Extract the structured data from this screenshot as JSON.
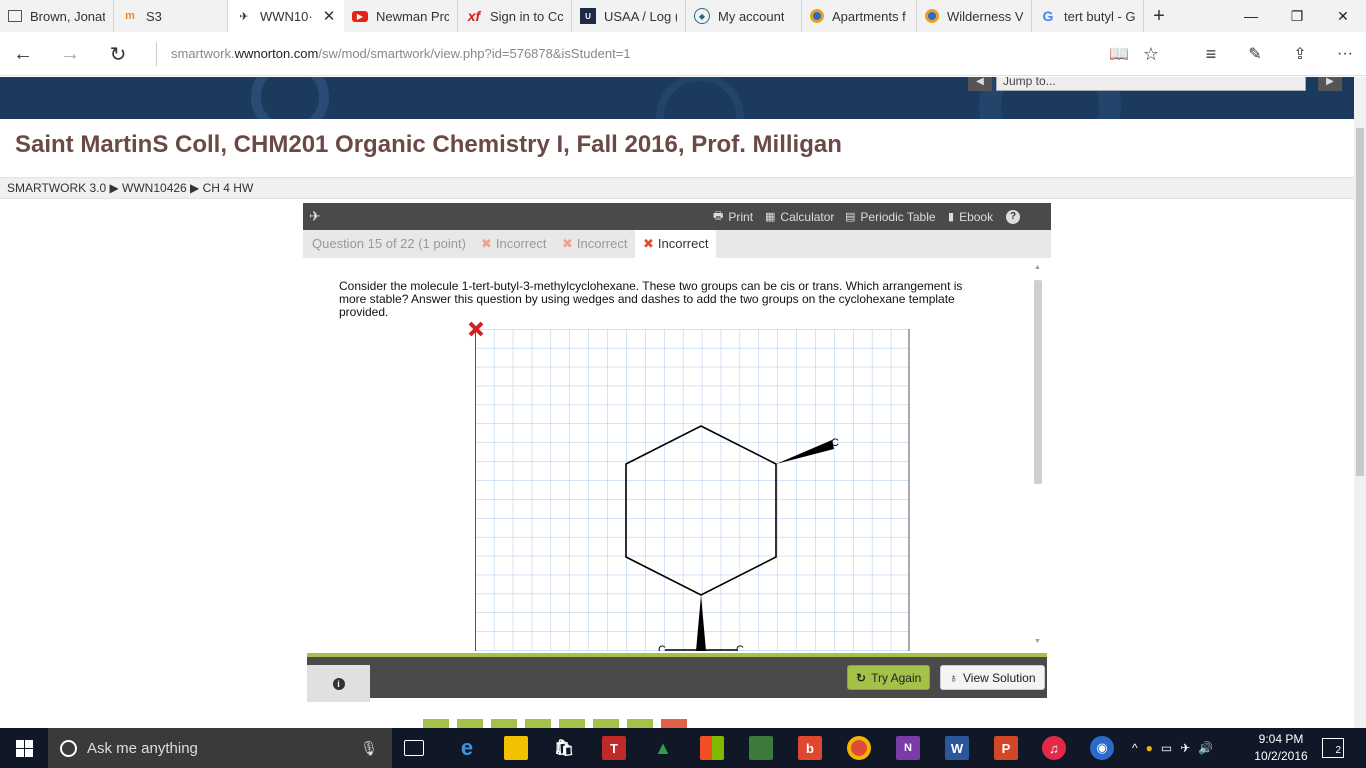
{
  "tabs": [
    {
      "icon": "document-icon",
      "label": "Brown, Jonat"
    },
    {
      "icon": "moodle-icon",
      "label": "S3"
    },
    {
      "icon": "norton-icon",
      "label": "WWN10·"
    },
    {
      "icon": "youtube-icon",
      "label": "Newman Prc"
    },
    {
      "icon": "xf-icon",
      "label": "Sign in to Cc"
    },
    {
      "icon": "usaa-icon",
      "label": "USAA / Log ("
    },
    {
      "icon": "account-icon",
      "label": "My account"
    },
    {
      "icon": "chrome-icon",
      "label": "Apartments f"
    },
    {
      "icon": "chrome-icon",
      "label": "Wilderness V"
    },
    {
      "icon": "google-icon",
      "label": "tert butyl - G"
    }
  ],
  "browser": {
    "url_prefix": "smartwork.",
    "url_domain": "wwnorton.com",
    "url_path": "/sw/mod/smartwork/view.php?id=576878&isStudent=1"
  },
  "banner": {
    "jump_label": "Jump to..."
  },
  "course_title": "Saint MartinS Coll, CHM201 Organic Chemistry I, Fall 2016, Prof. Milligan",
  "breadcrumb": "SMARTWORK 3.0 ▶ WWN10426 ▶ CH 4 HW",
  "toolbar": {
    "print": "Print",
    "calculator": "Calculator",
    "periodic_table": "Periodic Table",
    "ebook": "Ebook",
    "help": "?"
  },
  "question_tabs": {
    "info": "Question 15 of 22 (1 point)",
    "attempts": [
      "Incorrect",
      "Incorrect",
      "Incorrect"
    ],
    "mark": "✖"
  },
  "question_text": "Consider the molecule 1-tert-butyl-3-methylcyclohexane. These two groups can be cis or trans. Which arrangement is more stable? Answer this question by using wedges and dashes to add the two groups on the cyclohexane template provided.",
  "canvas": {
    "atom_label": "C"
  },
  "buttons": {
    "info": "i",
    "try_again": "Try Again",
    "view_solution": "View Solution"
  },
  "taskbar": {
    "search_placeholder": "Ask me anything",
    "time": "9:04 PM",
    "date": "10/2/2016",
    "notification_count": "2"
  },
  "colors": {
    "accent_green": "#a5c248",
    "banner_navy": "#1b3a5e",
    "title_brown": "#6b4a45",
    "incorrect_red": "#e05030"
  }
}
